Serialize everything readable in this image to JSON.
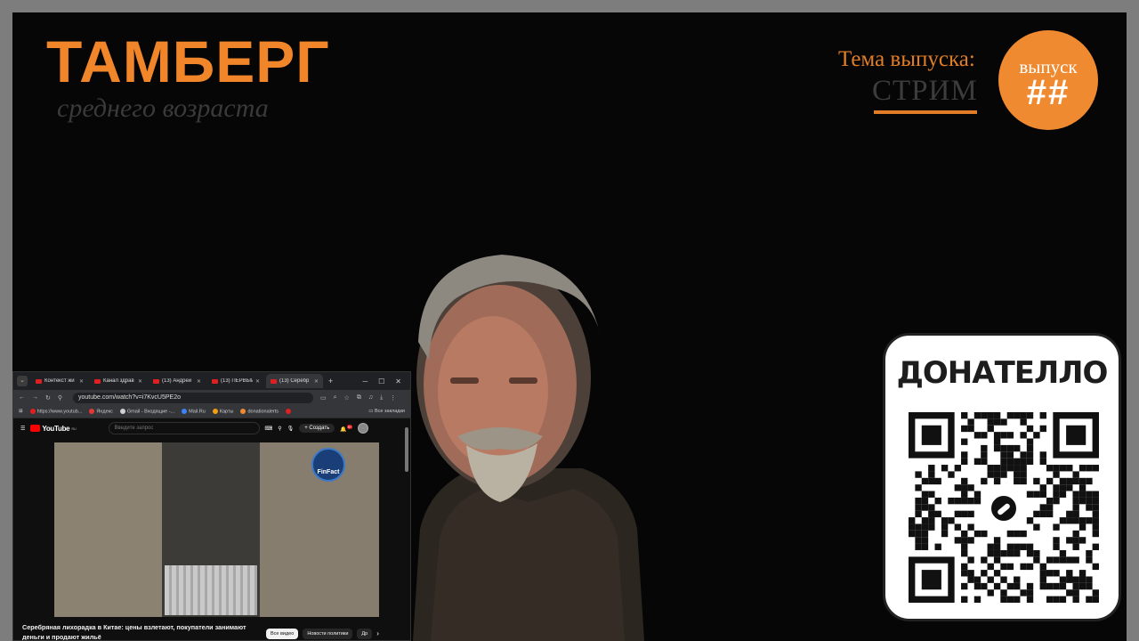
{
  "brand": {
    "title": "ТАМБЕРГ",
    "subtitle": "среднего возраста"
  },
  "topic": {
    "label": "Тема выпуска:",
    "value": "СТРИМ"
  },
  "episode": {
    "label": "выпуск",
    "number": "##"
  },
  "donate": {
    "title": "ДОНАТЕЛЛО",
    "qr_icon": "qr-code"
  },
  "browser": {
    "tabs": [
      {
        "label": "Контекст жи"
      },
      {
        "label": "Канал здрав"
      },
      {
        "label": "(13) Андрей"
      },
      {
        "label": "(13) ПЕРВЫЙ"
      },
      {
        "label": "(13) Серебр"
      }
    ],
    "url": "youtube.com/watch?v=i7KvcU5PE2o",
    "bookmarks": [
      {
        "label": "https://www.youtub..."
      },
      {
        "label": "Яндекс"
      },
      {
        "label": "Gmail - Входящие -..."
      },
      {
        "label": "Mail.Ru"
      },
      {
        "label": "Карты"
      },
      {
        "label": "donationalerts"
      }
    ],
    "all_bookmarks": "Все закладки"
  },
  "youtube": {
    "logo": "YouTube",
    "region": "RU",
    "search_placeholder": "Введите запрос",
    "create_label": "Создать",
    "notif_count": "9+",
    "channel_badge": "FinFact",
    "video_title": "Серебряная лихорадка в Китае: цены взлетают, покупатели занимают деньги и продают жильё",
    "chips": [
      "Все видео",
      "Новости политики",
      "Др"
    ]
  },
  "colors": {
    "accent": "#f0852a",
    "background": "#060606",
    "youtube_red": "#ff0000"
  }
}
